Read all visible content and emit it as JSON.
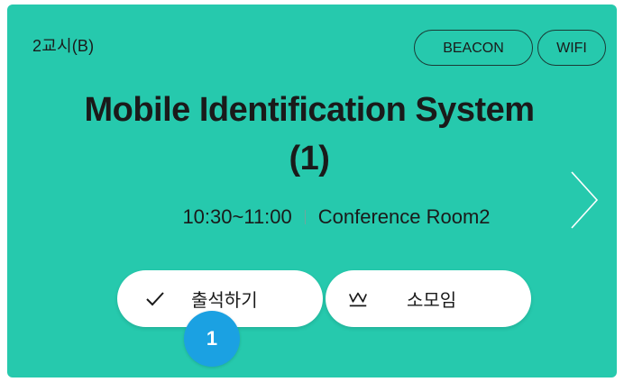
{
  "card": {
    "period": "2교시(B)",
    "tags": [
      "BEACON",
      "WIFI"
    ],
    "title_line1": "Mobile Identification System",
    "title_line2": "(1)",
    "time": "10:30~11:00",
    "room": "Conference Room2",
    "attend_label": "출석하기",
    "group_label": "소모임",
    "badge_number": "1"
  },
  "colors": {
    "card_bg": "#26c9ad",
    "badge_bg": "#1ba1e2",
    "text": "#1a1a1a"
  },
  "icons": {
    "attend": "check-icon",
    "group": "crown-icon",
    "next": "chevron-right-icon"
  }
}
